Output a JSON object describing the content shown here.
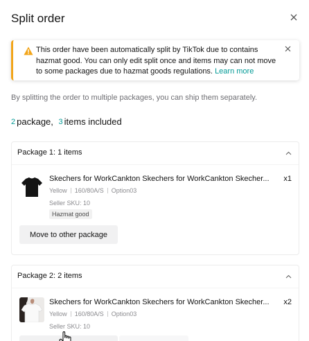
{
  "modal": {
    "title": "Split order",
    "close_icon": "close-icon"
  },
  "alert": {
    "icon": "warning-icon",
    "message": "This order have been automatically split by TikTok due to contains hazmat good. You can only edit split once and items may can not move to some packages due to hazmat goods regulations.",
    "link_label": "Learn more",
    "accent_color": "#F2A51A",
    "link_color": "#009995"
  },
  "intro_text": "By splitting the order to multiple packages, you can ship them separately.",
  "summary": {
    "package_count": "2",
    "package_label": "package,",
    "item_count": "3",
    "item_label": "items included"
  },
  "packages": [
    {
      "title": "Package 1: 1 items",
      "items": [
        {
          "name": "Skechers for WorkCankton Skechers for WorkCankton Skecher...",
          "quantity": "x1",
          "color": "Yellow",
          "size": "160/80A/S",
          "option": "Option03",
          "seller_sku": "Seller SKU: 10",
          "badge": "Hazmat good",
          "thumbnail": "black-tshirt"
        }
      ],
      "move_button": "Move to other package"
    },
    {
      "title": "Package 2: 2 items",
      "items": [
        {
          "name": "Skechers for WorkCankton Skechers for WorkCankton Skecher...",
          "quantity": "x2",
          "color": "Yellow",
          "size": "160/80A/S",
          "option": "Option03",
          "seller_sku": "Seller SKU: 10",
          "thumbnail": "white-tshirt-model"
        }
      ]
    }
  ]
}
